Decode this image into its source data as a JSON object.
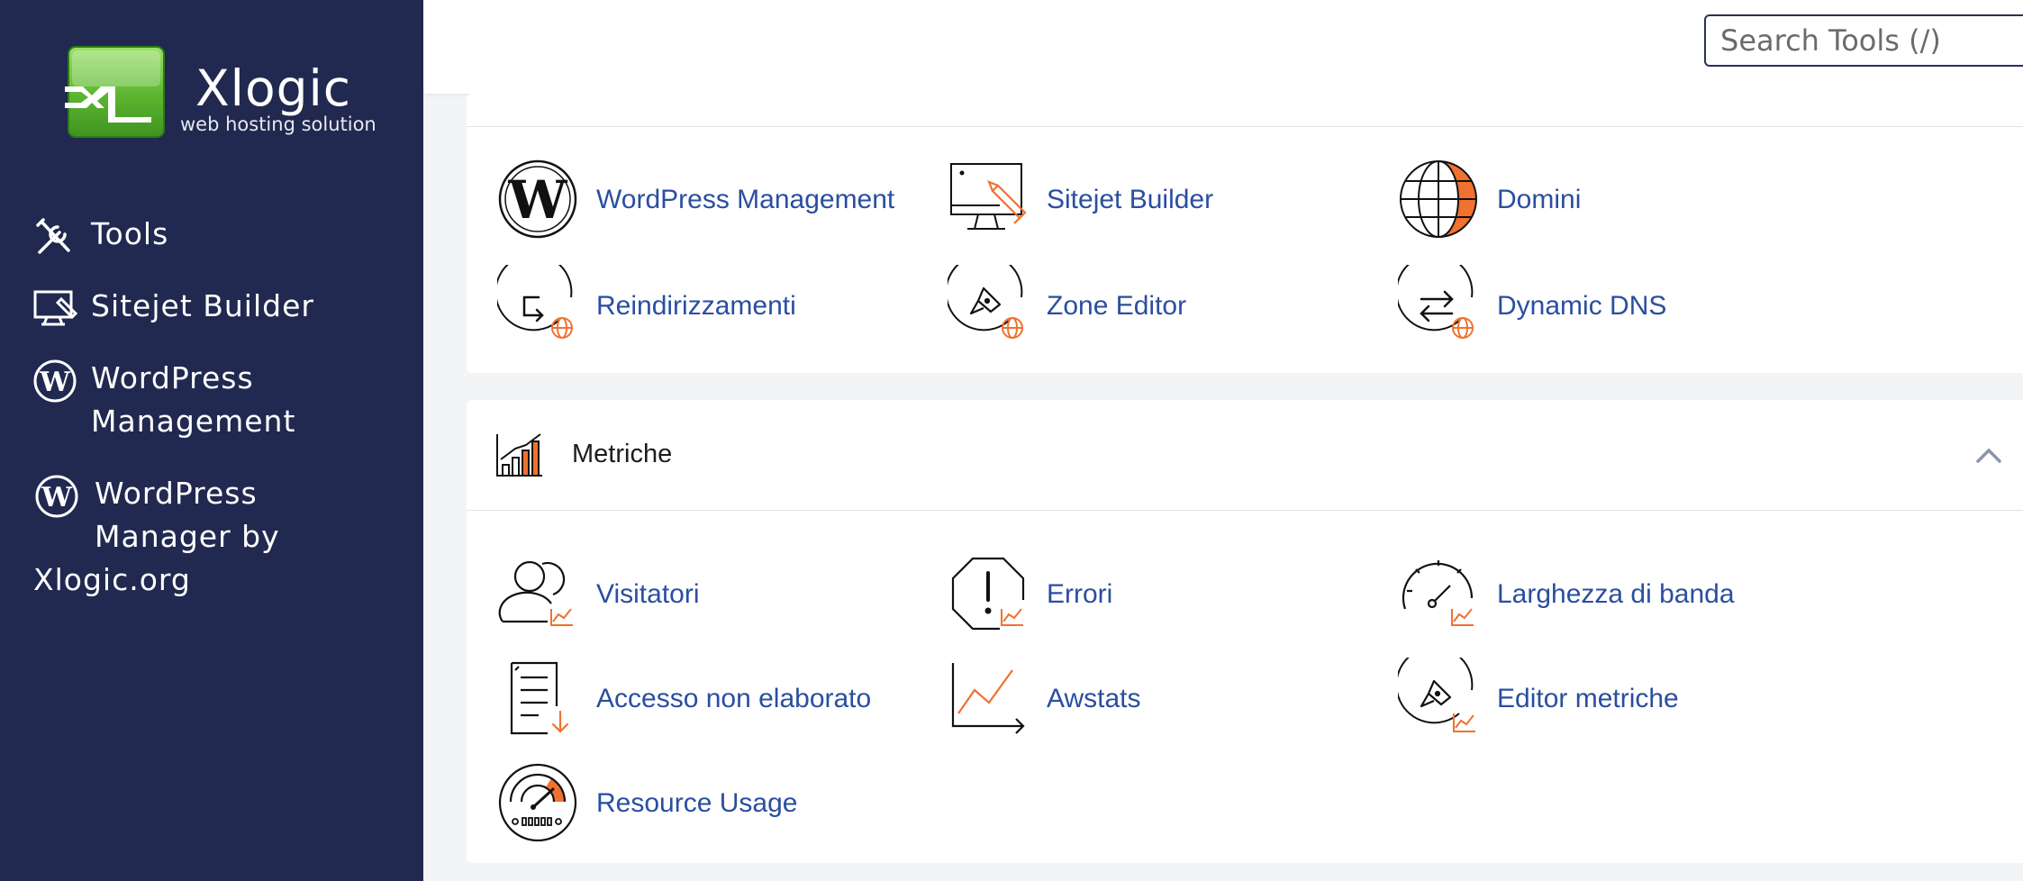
{
  "brand": {
    "name": "Xlogic",
    "tagline": "web hosting solution",
    "logo_letters": "XL"
  },
  "sidebar": {
    "items": [
      {
        "label": "Tools",
        "icon": "tools-icon"
      },
      {
        "label": "Sitejet Builder",
        "icon": "monitor-pencil-icon"
      },
      {
        "label_line1": "WordPress",
        "label_line2": "Management",
        "icon": "wordpress-icon"
      },
      {
        "label_line1": "WordPress",
        "label_line2": "Manager by",
        "label_line3": "Xlogic.org",
        "icon": "wordpress-icon"
      }
    ]
  },
  "search": {
    "placeholder": "Search Tools (/)",
    "value": ""
  },
  "domains_panel": {
    "tools": [
      {
        "label": "WordPress Management",
        "icon": "wordpress-icon"
      },
      {
        "label": "Sitejet Builder",
        "icon": "monitor-pencil-icon"
      },
      {
        "label": "Domini",
        "icon": "globe-icon"
      },
      {
        "label": "Reindirizzamenti",
        "icon": "redirect-icon"
      },
      {
        "label": "Zone Editor",
        "icon": "zone-editor-icon"
      },
      {
        "label": "Dynamic DNS",
        "icon": "dynamic-dns-icon"
      }
    ]
  },
  "metrics_panel": {
    "title": "Metriche",
    "tools": [
      {
        "label": "Visitatori",
        "icon": "visitors-icon"
      },
      {
        "label": "Errori",
        "icon": "errors-icon"
      },
      {
        "label": "Larghezza di banda",
        "icon": "bandwidth-icon"
      },
      {
        "label": "Accesso non elaborato",
        "icon": "raw-access-icon"
      },
      {
        "label": "Awstats",
        "icon": "awstats-icon"
      },
      {
        "label": "Editor metriche",
        "icon": "metrics-editor-icon"
      },
      {
        "label": "Resource Usage",
        "icon": "resource-usage-icon"
      }
    ]
  },
  "colors": {
    "sidebar_bg": "#212950",
    "link": "#2a4ea0",
    "accent_orange": "#f07130",
    "logo_green": "#6bbf3b"
  }
}
